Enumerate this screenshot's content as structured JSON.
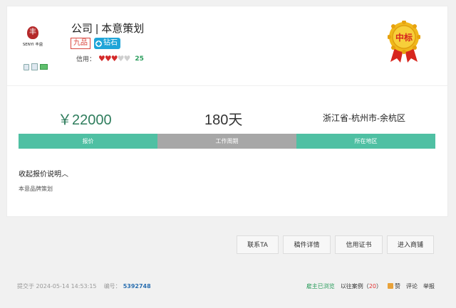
{
  "header": {
    "logo_text": "SENYI 丰益",
    "shop_name": "公司 | 本意策划",
    "tag_level": "九品",
    "tag_diamond": "钻石",
    "credit_label": "信用：",
    "credit_hearts_filled": 3,
    "credit_hearts_total": 5,
    "credit_score": "25",
    "won_badge": "中标"
  },
  "summary": {
    "price": "￥22000",
    "period": "180天",
    "region": "浙江省-杭州市-余杭区",
    "labels": [
      "报价",
      "工作周期",
      "所在地区"
    ]
  },
  "detail": {
    "toggle_label": "收起报价说明",
    "description": "本意品牌策划"
  },
  "actions": [
    "联系TA",
    "稿件详情",
    "信用证书",
    "进入商铺"
  ],
  "footer": {
    "submitted_prefix": "提交于",
    "submitted_time": "2024-05-14 14:53:15",
    "number_label": "编号：",
    "number": "5392748",
    "viewed": "雇主已浏览",
    "cases_label": "以往案例（",
    "cases_count": "20",
    "cases_suffix": "）",
    "like": "赞",
    "comment": "评论",
    "report": "举报"
  },
  "colors": {
    "accent_green": "#4fc0a3",
    "price_green": "#2f7d5d",
    "mid_gray": "#a7a7a7",
    "medal_gold": "#f0b81c",
    "medal_red": "#d7261e"
  }
}
